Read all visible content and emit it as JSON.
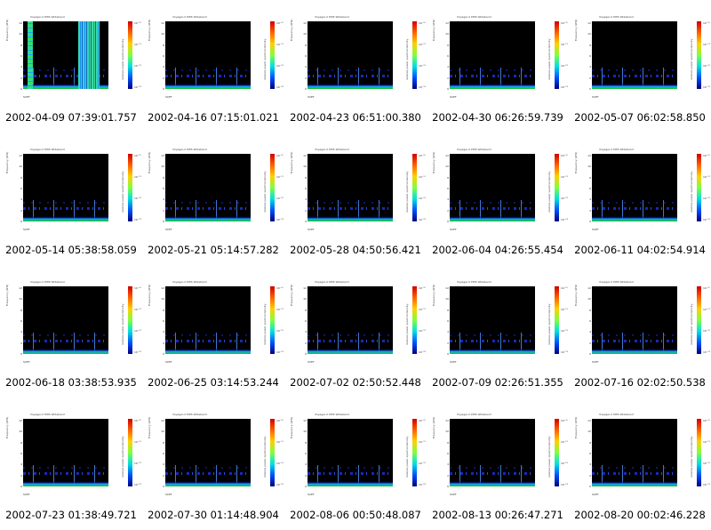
{
  "plot": {
    "title": "Voyager-2 PWS Wideband",
    "ylabel": "Frequency (kHz)",
    "yticks": [
      "12",
      "10",
      "8",
      "6",
      "4",
      "2",
      "0"
    ],
    "colorbar_label": "relative power spectral density",
    "colorbar_ticks": [
      "10⁻¹⁰",
      "10⁻¹¹",
      "10⁻¹²",
      "10⁻¹³"
    ],
    "scet_label": "SCET"
  },
  "captions": [
    "2002-04-09 07:39:01.757",
    "2002-04-16 07:15:01.021",
    "2002-04-23 06:51:00.380",
    "2002-04-30 06:26:59.739",
    "2002-05-07 06:02:58.850",
    "2002-05-14 05:38:58.059",
    "2002-05-21 05:14:57.282",
    "2002-05-28 04:50:56.421",
    "2002-06-04 04:26:55.454",
    "2002-06-11 04:02:54.914",
    "2002-06-18 03:38:53.935",
    "2002-06-25 03:14:53.244",
    "2002-07-02 02:50:52.448",
    "2002-07-09 02:26:51.355",
    "2002-07-16 02:02:50.538",
    "2002-07-23 01:38:49.721",
    "2002-07-30 01:14:48.904",
    "2002-08-06 00:50:48.087",
    "2002-08-13 00:26:47.271",
    "2002-08-20 00:02:46.228"
  ]
}
